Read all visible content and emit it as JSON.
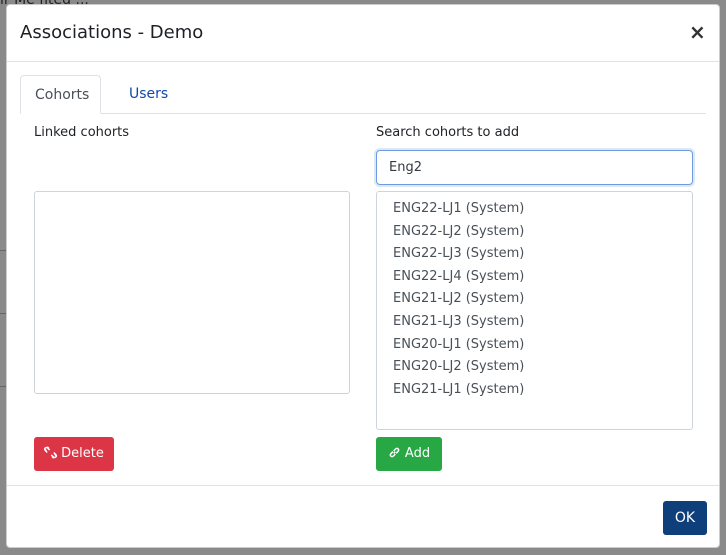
{
  "background": {
    "partial_text": "ir Me fited ..."
  },
  "modal": {
    "title": "Associations - Demo",
    "close_symbol": "×",
    "close_icon": "close-icon"
  },
  "tabs": [
    {
      "label": "Cohorts",
      "active": true
    },
    {
      "label": "Users",
      "active": false
    }
  ],
  "linked": {
    "label": "Linked cohorts",
    "items": []
  },
  "search": {
    "label": "Search cohorts to add",
    "value": "Eng2",
    "results": [
      "ENG22-LJ1 (System)",
      "ENG22-LJ2 (System)",
      "ENG22-LJ3 (System)",
      "ENG22-LJ4 (System)",
      "ENG21-LJ2 (System)",
      "ENG21-LJ3 (System)",
      "ENG20-LJ1 (System)",
      "ENG20-LJ2 (System)",
      "ENG21-LJ1 (System)"
    ]
  },
  "buttons": {
    "delete_label": "Delete",
    "delete_icon": "unlink-icon",
    "add_label": "Add",
    "add_icon": "link-icon",
    "ok_label": "OK"
  },
  "colors": {
    "delete": "#dc3545",
    "add": "#28a745",
    "ok": "#0f3f7a",
    "tab_link": "#0f47ad"
  }
}
